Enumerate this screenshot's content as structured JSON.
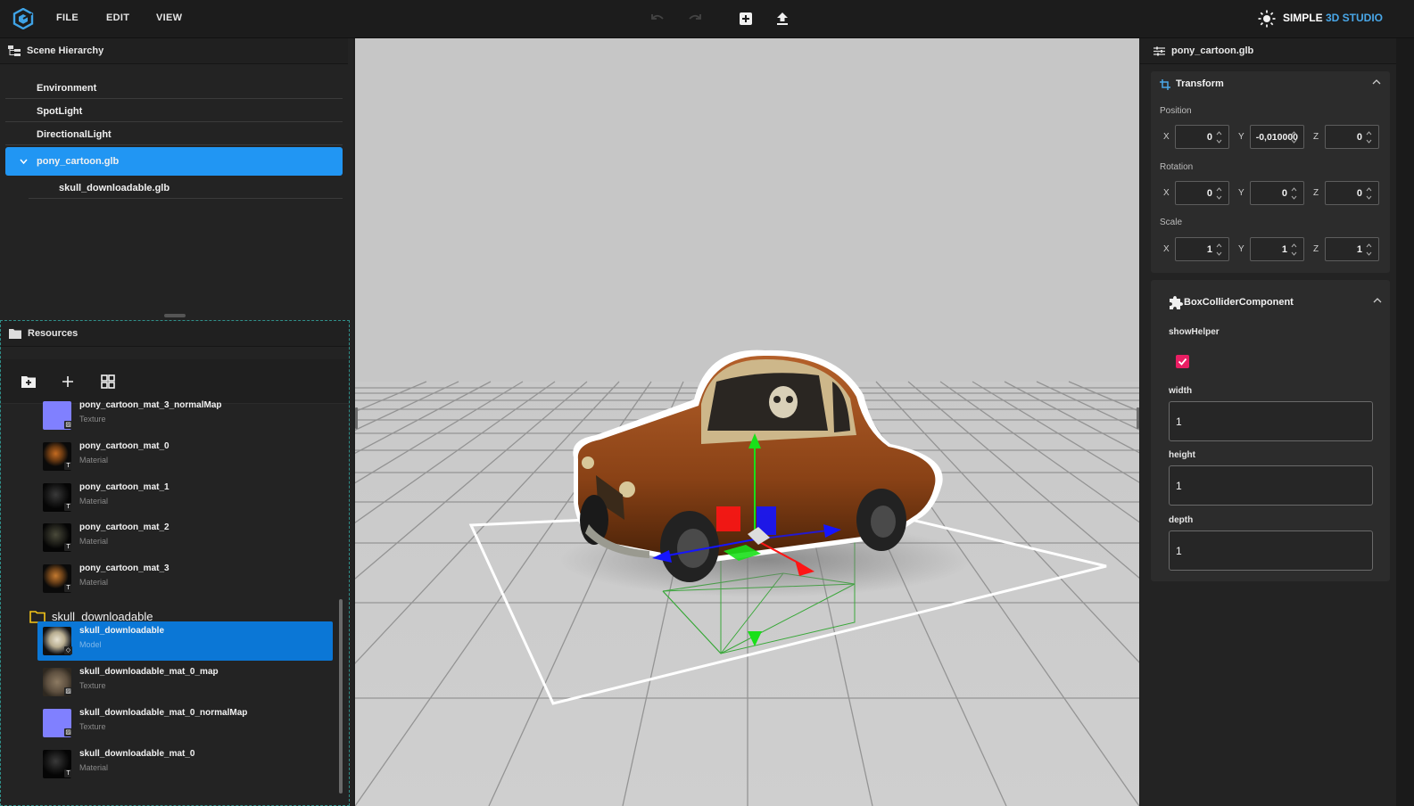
{
  "menu": [
    "FILE",
    "EDIT",
    "VIEW"
  ],
  "brand": {
    "light_prefix": "SIMPLE",
    "dark_part": "3D STUDIO"
  },
  "colors": {
    "accent": "#2196f3",
    "brand": "#49a7e8",
    "checkbox": "#e91e63",
    "selection_asset": "#0b77d6"
  },
  "hierarchy": {
    "title": "Scene Hierarchy",
    "items": [
      {
        "label": "Environment"
      },
      {
        "label": "SpotLight"
      },
      {
        "label": "DirectionalLight"
      },
      {
        "label": "pony_cartoon.glb",
        "selected": true,
        "expanded": true
      },
      {
        "label": "skull_downloadable.glb",
        "child": true
      }
    ]
  },
  "resources": {
    "title": "Resources",
    "toolbar_icons": [
      "new-folder-icon",
      "add-icon",
      "grid-view-icon"
    ],
    "assets_top": [
      {
        "name": "pony_cartoon_mat_3_normalMap",
        "kind": "Texture"
      },
      {
        "name": "pony_cartoon_mat_0",
        "kind": "Material"
      },
      {
        "name": "pony_cartoon_mat_1",
        "kind": "Material"
      },
      {
        "name": "pony_cartoon_mat_2",
        "kind": "Material"
      },
      {
        "name": "pony_cartoon_mat_3",
        "kind": "Material"
      }
    ],
    "folder": "skull_downloadable",
    "assets_bottom": [
      {
        "name": "skull_downloadable",
        "kind": "Model",
        "selected": true
      },
      {
        "name": "skull_downloadable_mat_0_map",
        "kind": "Texture"
      },
      {
        "name": "skull_downloadable_mat_0_normalMap",
        "kind": "Texture"
      },
      {
        "name": "skull_downloadable_mat_0",
        "kind": "Material"
      }
    ]
  },
  "inspector": {
    "title": "pony_cartoon.glb",
    "transform": {
      "title": "Transform",
      "position_label": "Position",
      "rotation_label": "Rotation",
      "scale_label": "Scale",
      "axes": [
        "X",
        "Y",
        "Z"
      ],
      "position": [
        "0",
        "-0,010000",
        "0"
      ],
      "rotation": [
        "0",
        "0",
        "0"
      ],
      "scale": [
        "1",
        "1",
        "1"
      ]
    },
    "collider": {
      "title": "BoxColliderComponent",
      "show_helper_label": "showHelper",
      "show_helper": true,
      "width_label": "width",
      "width": "1",
      "height_label": "height",
      "height": "1",
      "depth_label": "depth",
      "depth": "1"
    }
  }
}
